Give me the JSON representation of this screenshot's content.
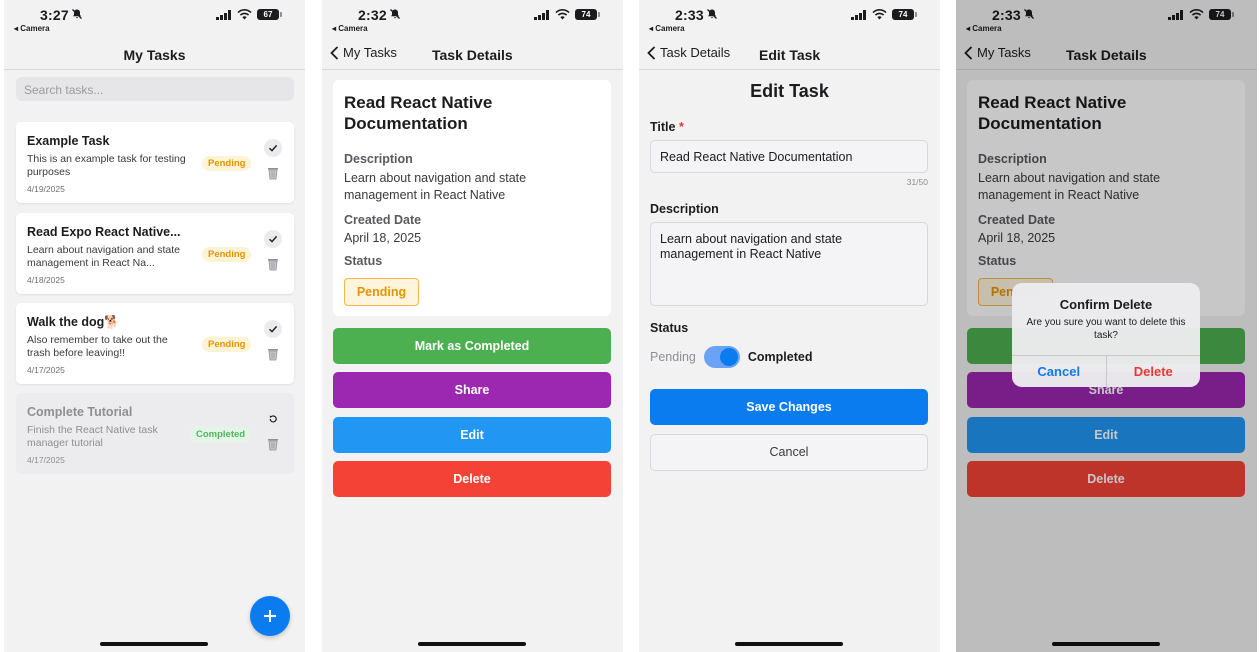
{
  "colors": {
    "primary": "#0a7cf0",
    "green": "#4caf50",
    "purple": "#9c27b0",
    "blue": "#2196f3",
    "red": "#f44336",
    "pending": "#e59400",
    "completed": "#53b463"
  },
  "screens": [
    {
      "status": {
        "time": "3:27",
        "battery": "67",
        "back_app": "◂ Camera"
      },
      "nav": {
        "title": "My Tasks"
      },
      "search": {
        "placeholder": "Search tasks..."
      },
      "tasks": [
        {
          "title": "Example Task",
          "desc": "This is an example task for testing purposes",
          "date": "4/19/2025",
          "status": "Pending",
          "action_icon": "checkmark-icon"
        },
        {
          "title": "Read Expo React Native...",
          "desc": "Learn about navigation and state management in React Na...",
          "date": "4/18/2025",
          "status": "Pending",
          "action_icon": "checkmark-icon"
        },
        {
          "title": "Walk the dog🐕",
          "desc": " Also remember to take out the trash before leaving!!",
          "date": "4/17/2025",
          "status": "Pending",
          "action_icon": "checkmark-icon"
        },
        {
          "title": "Complete Tutorial",
          "desc": "Finish the React Native task manager tutorial",
          "date": "4/17/2025",
          "status": "Completed",
          "action_icon": "undo-icon"
        }
      ],
      "fab": {
        "icon": "plus-icon"
      }
    },
    {
      "status": {
        "time": "2:32",
        "battery": "74",
        "back_app": "◂ Camera"
      },
      "nav": {
        "back": "My Tasks",
        "title": "Task Details"
      },
      "detail": {
        "title": "Read React Native Documentation",
        "description_label": "Description",
        "description": "Learn about navigation and state management in React Native",
        "created_label": "Created Date",
        "created": "April 18, 2025",
        "status_label": "Status",
        "status": "Pending"
      },
      "actions": {
        "complete": "Mark as Completed",
        "share": "Share",
        "edit": "Edit",
        "delete": "Delete"
      }
    },
    {
      "status": {
        "time": "2:33",
        "battery": "74",
        "back_app": "◂ Camera"
      },
      "nav": {
        "back": "Task Details",
        "title": "Edit Task"
      },
      "form": {
        "heading": "Edit Task",
        "title_label": "Title",
        "required_mark": "*",
        "title_value": "Read React Native Documentation",
        "counter": "31/50",
        "description_label": "Description",
        "description_value": "Learn about navigation and state management in React Native",
        "status_label": "Status",
        "toggle_off_label": "Pending",
        "toggle_on_label": "Completed",
        "toggle_on": true,
        "save": "Save Changes",
        "cancel": "Cancel"
      }
    },
    {
      "status": {
        "time": "2:33",
        "battery": "74",
        "back_app": "◂ Camera"
      },
      "nav": {
        "back": "My Tasks",
        "title": "Task Details"
      },
      "detail": {
        "title": "Read React Native Documentation",
        "description_label": "Description",
        "description": "Learn about navigation and state management in React Native",
        "created_label": "Created Date",
        "created": "April 18, 2025",
        "status_label": "Status",
        "status": "Pending"
      },
      "actions": {
        "share": "Share",
        "edit": "Edit",
        "delete": "Delete"
      },
      "alert": {
        "title": "Confirm Delete",
        "message": "Are you sure you want to delete this task?",
        "cancel": "Cancel",
        "delete": "Delete"
      }
    }
  ]
}
